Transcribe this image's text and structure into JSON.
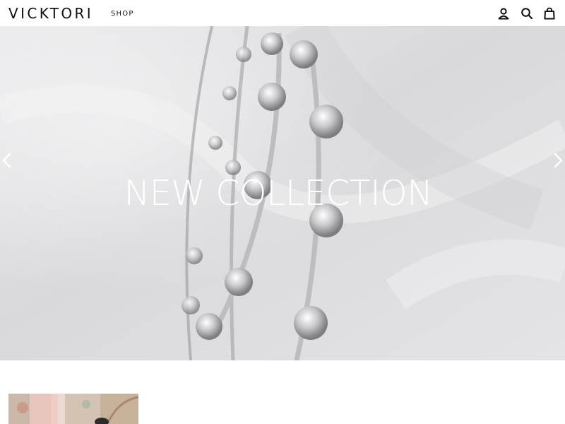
{
  "header": {
    "logo": "VICKTORI",
    "nav": {
      "shop_label": "SHOP"
    },
    "icons": {
      "account": "person-icon",
      "search": "search-icon",
      "cart": "bag-icon"
    }
  },
  "hero": {
    "title": "NEW COLLECTION",
    "prev_icon": "chevron-left-icon",
    "next_icon": "chevron-right-icon"
  },
  "colors": {
    "text": "#111111",
    "background": "#ffffff",
    "hero_title": "#ffffff"
  }
}
